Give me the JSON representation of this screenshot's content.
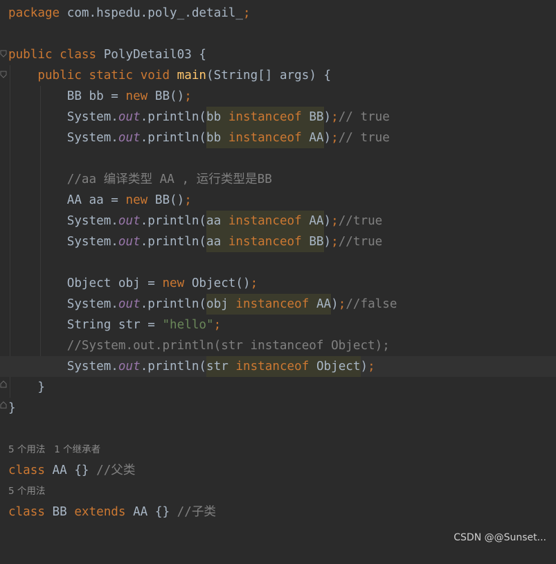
{
  "editor": {
    "lines": {
      "l1": {
        "package_kw": "package",
        "package_name": " com.hspedu.poly_.detail_",
        "semicolon": ";"
      },
      "l3": {
        "public_kw": "public",
        "class_kw": "class",
        "class_name": "PolyDetail03 {"
      },
      "l4": {
        "public_kw": "public",
        "static_kw": "static",
        "void_kw": "void",
        "method_name": "main",
        "params": "(String[] args) {"
      },
      "l5": {
        "decl": "BB bb = ",
        "new_kw": "new",
        "ctor": " BB()",
        "semicolon": ";"
      },
      "l6": {
        "system": "System.",
        "out": "out",
        "println": ".println(",
        "var": "bb",
        "instanceof_kw": "instanceof",
        "type": "BB",
        "close": ")",
        "semicolon": ";",
        "comment": "// true"
      },
      "l7": {
        "system": "System.",
        "out": "out",
        "println": ".println(",
        "var": "bb",
        "instanceof_kw": "instanceof",
        "type": "AA",
        "close": ")",
        "semicolon": ";",
        "comment": "// true"
      },
      "l9": {
        "comment": "//aa 编译类型 AA , 运行类型是BB"
      },
      "l10": {
        "decl": "AA aa = ",
        "new_kw": "new",
        "ctor": " BB()",
        "semicolon": ";"
      },
      "l11": {
        "system": "System.",
        "out": "out",
        "println": ".println(",
        "var": "aa",
        "instanceof_kw": "instanceof",
        "type": "AA",
        "close": ")",
        "semicolon": ";",
        "comment": "//true"
      },
      "l12": {
        "system": "System.",
        "out": "out",
        "println": ".println(",
        "var": "aa",
        "instanceof_kw": "instanceof",
        "type": "BB",
        "close": ")",
        "semicolon": ";",
        "comment": "//true"
      },
      "l14": {
        "decl": "Object obj = ",
        "new_kw": "new",
        "ctor": " Object()",
        "semicolon": ";"
      },
      "l15": {
        "system": "System.",
        "out": "out",
        "println": ".println(",
        "var": "obj",
        "instanceof_kw": "instanceof",
        "type": "AA",
        "close": ")",
        "semicolon": ";",
        "comment": "//false"
      },
      "l16": {
        "decl": "String str = ",
        "string": "\"hello\"",
        "semicolon": ";"
      },
      "l17": {
        "comment": "//System.out.println(str instanceof Object);"
      },
      "l18": {
        "system": "System.",
        "out": "out",
        "println": ".println(",
        "var": "str",
        "instanceof_kw": "instanceof",
        "type": "Object",
        "close": ")",
        "semicolon": ";"
      },
      "l19": {
        "brace": "}"
      },
      "l20": {
        "brace": "}"
      },
      "l22": {
        "class_kw": "class",
        "rest": " AA {} ",
        "comment": "//父类"
      },
      "l24": {
        "class_kw": "class",
        "name": " BB ",
        "extends_kw": "extends",
        "rest": " AA {} ",
        "comment": "//子类"
      }
    },
    "codevision": {
      "aa_usages": "5 个用法",
      "aa_inheritors": "1 个继承者",
      "bb_usages": "5 个用法"
    }
  },
  "watermark": "CSDN @@Sunset...",
  "colors": {
    "background": "#2b2b2b",
    "keyword": "#cc7832",
    "method": "#ffc66d",
    "static_field": "#9876aa",
    "string": "#6a8759",
    "comment": "#808080",
    "text": "#a9b7c6",
    "current_line": "#323232",
    "highlight": "#3b3b2c"
  }
}
